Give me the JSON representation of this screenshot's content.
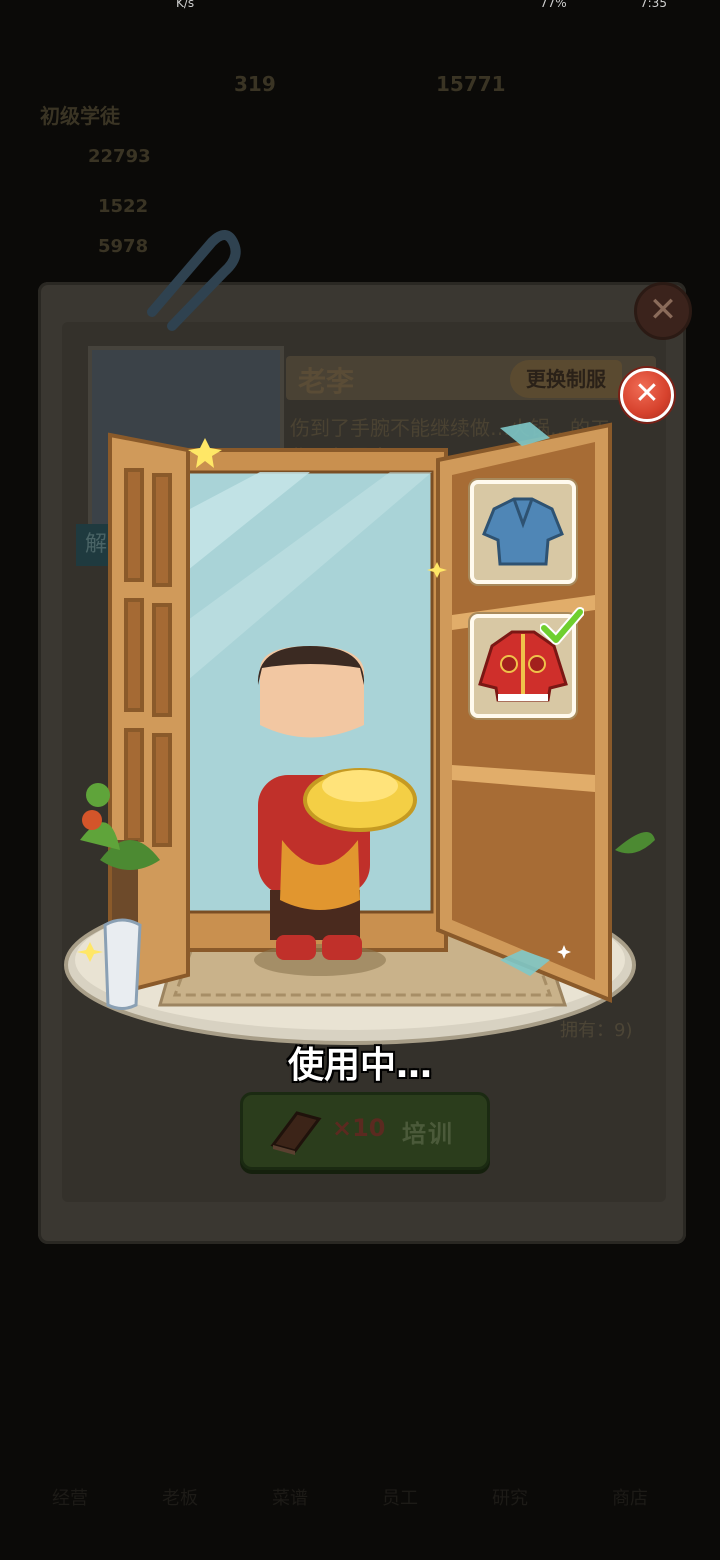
{
  "status_bar": {
    "speed": "K/s",
    "battery": "77%",
    "time": "7:35"
  },
  "hud": {
    "level_title": "初级学徒",
    "coins": "319",
    "gems": "15771",
    "stat_a": "22793",
    "stat_b": "1522",
    "stat_c": "5978"
  },
  "card": {
    "name": "老李",
    "change_uniform_label": "更换制服",
    "description": "伤到了手腕不能继续做…火锅…的工作，但是大…",
    "unlock_tab": "解",
    "owned_text": "拥有：9)"
  },
  "wardrobe": {
    "outfits": [
      {
        "icon": "blue-robe-icon",
        "selected": false
      },
      {
        "icon": "red-tang-jacket-icon",
        "selected": true
      }
    ]
  },
  "using_text": "使用中…",
  "train_button": {
    "count": "×10",
    "label": "培训"
  },
  "bottom_nav": {
    "items": [
      "经营",
      "老板",
      "菜谱",
      "员工",
      "研究",
      "商店"
    ]
  },
  "colors": {
    "close_red": "#d6422d",
    "train_green": "#2b3d1c",
    "check_green": "#6fcf2f",
    "wood": "#c9904f"
  }
}
